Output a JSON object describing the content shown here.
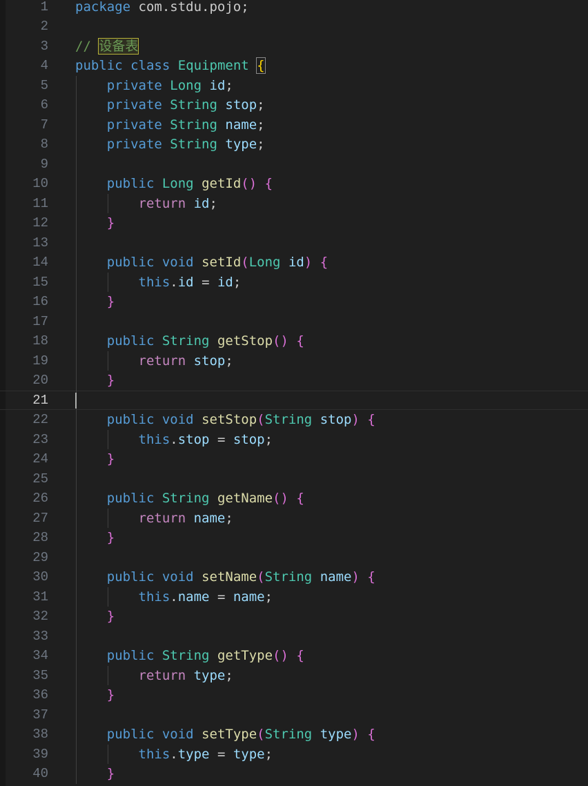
{
  "editor": {
    "lines": [
      {
        "n": "1",
        "tokens": [
          {
            "t": "package",
            "c": "kw"
          },
          {
            "t": " com.stdu.pojo;",
            "c": "txt"
          }
        ]
      },
      {
        "n": "2",
        "tokens": []
      },
      {
        "n": "3",
        "tokens": [
          {
            "t": "// ",
            "c": "cmt"
          },
          {
            "t": "设备表",
            "c": "cjk"
          }
        ]
      },
      {
        "n": "4",
        "tokens": [
          {
            "t": "public",
            "c": "kw"
          },
          {
            "t": " ",
            "c": "txt"
          },
          {
            "t": "class",
            "c": "kw"
          },
          {
            "t": " ",
            "c": "txt"
          },
          {
            "t": "Equipment",
            "c": "typ"
          },
          {
            "t": " ",
            "c": "txt"
          },
          {
            "t": "{",
            "c": "br1m"
          }
        ]
      },
      {
        "n": "5",
        "tokens": [
          {
            "t": "    ",
            "c": "txt"
          },
          {
            "t": "private",
            "c": "kw"
          },
          {
            "t": " ",
            "c": "txt"
          },
          {
            "t": "Long",
            "c": "typ"
          },
          {
            "t": " ",
            "c": "txt"
          },
          {
            "t": "id",
            "c": "var"
          },
          {
            "t": ";",
            "c": "txt"
          }
        ]
      },
      {
        "n": "6",
        "tokens": [
          {
            "t": "    ",
            "c": "txt"
          },
          {
            "t": "private",
            "c": "kw"
          },
          {
            "t": " ",
            "c": "txt"
          },
          {
            "t": "String",
            "c": "typ"
          },
          {
            "t": " ",
            "c": "txt"
          },
          {
            "t": "stop",
            "c": "var"
          },
          {
            "t": ";",
            "c": "txt"
          }
        ]
      },
      {
        "n": "7",
        "tokens": [
          {
            "t": "    ",
            "c": "txt"
          },
          {
            "t": "private",
            "c": "kw"
          },
          {
            "t": " ",
            "c": "txt"
          },
          {
            "t": "String",
            "c": "typ"
          },
          {
            "t": " ",
            "c": "txt"
          },
          {
            "t": "name",
            "c": "var"
          },
          {
            "t": ";",
            "c": "txt"
          }
        ]
      },
      {
        "n": "8",
        "tokens": [
          {
            "t": "    ",
            "c": "txt"
          },
          {
            "t": "private",
            "c": "kw"
          },
          {
            "t": " ",
            "c": "txt"
          },
          {
            "t": "String",
            "c": "typ"
          },
          {
            "t": " ",
            "c": "txt"
          },
          {
            "t": "type",
            "c": "var"
          },
          {
            "t": ";",
            "c": "txt"
          }
        ]
      },
      {
        "n": "9",
        "tokens": []
      },
      {
        "n": "10",
        "tokens": [
          {
            "t": "    ",
            "c": "txt"
          },
          {
            "t": "public",
            "c": "kw"
          },
          {
            "t": " ",
            "c": "txt"
          },
          {
            "t": "Long",
            "c": "typ"
          },
          {
            "t": " ",
            "c": "txt"
          },
          {
            "t": "getId",
            "c": "fn"
          },
          {
            "t": "()",
            "c": "br2"
          },
          {
            "t": " ",
            "c": "txt"
          },
          {
            "t": "{",
            "c": "br2"
          }
        ]
      },
      {
        "n": "11",
        "tokens": [
          {
            "t": "        ",
            "c": "txt"
          },
          {
            "t": "return",
            "c": "ctl"
          },
          {
            "t": " ",
            "c": "txt"
          },
          {
            "t": "id",
            "c": "var"
          },
          {
            "t": ";",
            "c": "txt"
          }
        ]
      },
      {
        "n": "12",
        "tokens": [
          {
            "t": "    ",
            "c": "txt"
          },
          {
            "t": "}",
            "c": "br2"
          }
        ]
      },
      {
        "n": "13",
        "tokens": []
      },
      {
        "n": "14",
        "tokens": [
          {
            "t": "    ",
            "c": "txt"
          },
          {
            "t": "public",
            "c": "kw"
          },
          {
            "t": " ",
            "c": "txt"
          },
          {
            "t": "void",
            "c": "kw"
          },
          {
            "t": " ",
            "c": "txt"
          },
          {
            "t": "setId",
            "c": "fn"
          },
          {
            "t": "(",
            "c": "br2"
          },
          {
            "t": "Long",
            "c": "typ"
          },
          {
            "t": " ",
            "c": "txt"
          },
          {
            "t": "id",
            "c": "var"
          },
          {
            "t": ")",
            "c": "br2"
          },
          {
            "t": " ",
            "c": "txt"
          },
          {
            "t": "{",
            "c": "br2"
          }
        ]
      },
      {
        "n": "15",
        "tokens": [
          {
            "t": "        ",
            "c": "txt"
          },
          {
            "t": "this",
            "c": "kw"
          },
          {
            "t": ".",
            "c": "txt"
          },
          {
            "t": "id",
            "c": "var"
          },
          {
            "t": " = ",
            "c": "txt"
          },
          {
            "t": "id",
            "c": "var"
          },
          {
            "t": ";",
            "c": "txt"
          }
        ]
      },
      {
        "n": "16",
        "tokens": [
          {
            "t": "    ",
            "c": "txt"
          },
          {
            "t": "}",
            "c": "br2"
          }
        ]
      },
      {
        "n": "17",
        "tokens": []
      },
      {
        "n": "18",
        "tokens": [
          {
            "t": "    ",
            "c": "txt"
          },
          {
            "t": "public",
            "c": "kw"
          },
          {
            "t": " ",
            "c": "txt"
          },
          {
            "t": "String",
            "c": "typ"
          },
          {
            "t": " ",
            "c": "txt"
          },
          {
            "t": "getStop",
            "c": "fn"
          },
          {
            "t": "()",
            "c": "br2"
          },
          {
            "t": " ",
            "c": "txt"
          },
          {
            "t": "{",
            "c": "br2"
          }
        ]
      },
      {
        "n": "19",
        "tokens": [
          {
            "t": "        ",
            "c": "txt"
          },
          {
            "t": "return",
            "c": "ctl"
          },
          {
            "t": " ",
            "c": "txt"
          },
          {
            "t": "stop",
            "c": "var"
          },
          {
            "t": ";",
            "c": "txt"
          }
        ]
      },
      {
        "n": "20",
        "tokens": [
          {
            "t": "    ",
            "c": "txt"
          },
          {
            "t": "}",
            "c": "br2"
          }
        ]
      },
      {
        "n": "21",
        "tokens": []
      },
      {
        "n": "22",
        "tokens": [
          {
            "t": "    ",
            "c": "txt"
          },
          {
            "t": "public",
            "c": "kw"
          },
          {
            "t": " ",
            "c": "txt"
          },
          {
            "t": "void",
            "c": "kw"
          },
          {
            "t": " ",
            "c": "txt"
          },
          {
            "t": "setStop",
            "c": "fn"
          },
          {
            "t": "(",
            "c": "br2"
          },
          {
            "t": "String",
            "c": "typ"
          },
          {
            "t": " ",
            "c": "txt"
          },
          {
            "t": "stop",
            "c": "var"
          },
          {
            "t": ")",
            "c": "br2"
          },
          {
            "t": " ",
            "c": "txt"
          },
          {
            "t": "{",
            "c": "br2"
          }
        ]
      },
      {
        "n": "23",
        "tokens": [
          {
            "t": "        ",
            "c": "txt"
          },
          {
            "t": "this",
            "c": "kw"
          },
          {
            "t": ".",
            "c": "txt"
          },
          {
            "t": "stop",
            "c": "var"
          },
          {
            "t": " = ",
            "c": "txt"
          },
          {
            "t": "stop",
            "c": "var"
          },
          {
            "t": ";",
            "c": "txt"
          }
        ]
      },
      {
        "n": "24",
        "tokens": [
          {
            "t": "    ",
            "c": "txt"
          },
          {
            "t": "}",
            "c": "br2"
          }
        ]
      },
      {
        "n": "25",
        "tokens": []
      },
      {
        "n": "26",
        "tokens": [
          {
            "t": "    ",
            "c": "txt"
          },
          {
            "t": "public",
            "c": "kw"
          },
          {
            "t": " ",
            "c": "txt"
          },
          {
            "t": "String",
            "c": "typ"
          },
          {
            "t": " ",
            "c": "txt"
          },
          {
            "t": "getName",
            "c": "fn"
          },
          {
            "t": "()",
            "c": "br2"
          },
          {
            "t": " ",
            "c": "txt"
          },
          {
            "t": "{",
            "c": "br2"
          }
        ]
      },
      {
        "n": "27",
        "tokens": [
          {
            "t": "        ",
            "c": "txt"
          },
          {
            "t": "return",
            "c": "ctl"
          },
          {
            "t": " ",
            "c": "txt"
          },
          {
            "t": "name",
            "c": "var"
          },
          {
            "t": ";",
            "c": "txt"
          }
        ]
      },
      {
        "n": "28",
        "tokens": [
          {
            "t": "    ",
            "c": "txt"
          },
          {
            "t": "}",
            "c": "br2"
          }
        ]
      },
      {
        "n": "29",
        "tokens": []
      },
      {
        "n": "30",
        "tokens": [
          {
            "t": "    ",
            "c": "txt"
          },
          {
            "t": "public",
            "c": "kw"
          },
          {
            "t": " ",
            "c": "txt"
          },
          {
            "t": "void",
            "c": "kw"
          },
          {
            "t": " ",
            "c": "txt"
          },
          {
            "t": "setName",
            "c": "fn"
          },
          {
            "t": "(",
            "c": "br2"
          },
          {
            "t": "String",
            "c": "typ"
          },
          {
            "t": " ",
            "c": "txt"
          },
          {
            "t": "name",
            "c": "var"
          },
          {
            "t": ")",
            "c": "br2"
          },
          {
            "t": " ",
            "c": "txt"
          },
          {
            "t": "{",
            "c": "br2"
          }
        ]
      },
      {
        "n": "31",
        "tokens": [
          {
            "t": "        ",
            "c": "txt"
          },
          {
            "t": "this",
            "c": "kw"
          },
          {
            "t": ".",
            "c": "txt"
          },
          {
            "t": "name",
            "c": "var"
          },
          {
            "t": " = ",
            "c": "txt"
          },
          {
            "t": "name",
            "c": "var"
          },
          {
            "t": ";",
            "c": "txt"
          }
        ]
      },
      {
        "n": "32",
        "tokens": [
          {
            "t": "    ",
            "c": "txt"
          },
          {
            "t": "}",
            "c": "br2"
          }
        ]
      },
      {
        "n": "33",
        "tokens": []
      },
      {
        "n": "34",
        "tokens": [
          {
            "t": "    ",
            "c": "txt"
          },
          {
            "t": "public",
            "c": "kw"
          },
          {
            "t": " ",
            "c": "txt"
          },
          {
            "t": "String",
            "c": "typ"
          },
          {
            "t": " ",
            "c": "txt"
          },
          {
            "t": "getType",
            "c": "fn"
          },
          {
            "t": "()",
            "c": "br2"
          },
          {
            "t": " ",
            "c": "txt"
          },
          {
            "t": "{",
            "c": "br2"
          }
        ]
      },
      {
        "n": "35",
        "tokens": [
          {
            "t": "        ",
            "c": "txt"
          },
          {
            "t": "return",
            "c": "ctl"
          },
          {
            "t": " ",
            "c": "txt"
          },
          {
            "t": "type",
            "c": "var"
          },
          {
            "t": ";",
            "c": "txt"
          }
        ]
      },
      {
        "n": "36",
        "tokens": [
          {
            "t": "    ",
            "c": "txt"
          },
          {
            "t": "}",
            "c": "br2"
          }
        ]
      },
      {
        "n": "37",
        "tokens": []
      },
      {
        "n": "38",
        "tokens": [
          {
            "t": "    ",
            "c": "txt"
          },
          {
            "t": "public",
            "c": "kw"
          },
          {
            "t": " ",
            "c": "txt"
          },
          {
            "t": "void",
            "c": "kw"
          },
          {
            "t": " ",
            "c": "txt"
          },
          {
            "t": "setType",
            "c": "fn"
          },
          {
            "t": "(",
            "c": "br2"
          },
          {
            "t": "String",
            "c": "typ"
          },
          {
            "t": " ",
            "c": "txt"
          },
          {
            "t": "type",
            "c": "var"
          },
          {
            "t": ")",
            "c": "br2"
          },
          {
            "t": " ",
            "c": "txt"
          },
          {
            "t": "{",
            "c": "br2"
          }
        ]
      },
      {
        "n": "39",
        "tokens": [
          {
            "t": "        ",
            "c": "txt"
          },
          {
            "t": "this",
            "c": "kw"
          },
          {
            "t": ".",
            "c": "txt"
          },
          {
            "t": "type",
            "c": "var"
          },
          {
            "t": " = ",
            "c": "txt"
          },
          {
            "t": "type",
            "c": "var"
          },
          {
            "t": ";",
            "c": "txt"
          }
        ]
      },
      {
        "n": "40",
        "tokens": [
          {
            "t": "    ",
            "c": "txt"
          },
          {
            "t": "}",
            "c": "br2"
          }
        ]
      }
    ],
    "current_line": "21",
    "colors": {
      "background": "#1f1f1f",
      "keyword": "#569cd6",
      "control": "#c586c0",
      "type": "#4ec9b0",
      "function": "#dcdcaa",
      "variable": "#9cdcfe",
      "comment": "#6a9955",
      "bracket_level1": "#ffd700",
      "bracket_level2": "#da70d6",
      "line_number": "#6e7681"
    }
  }
}
